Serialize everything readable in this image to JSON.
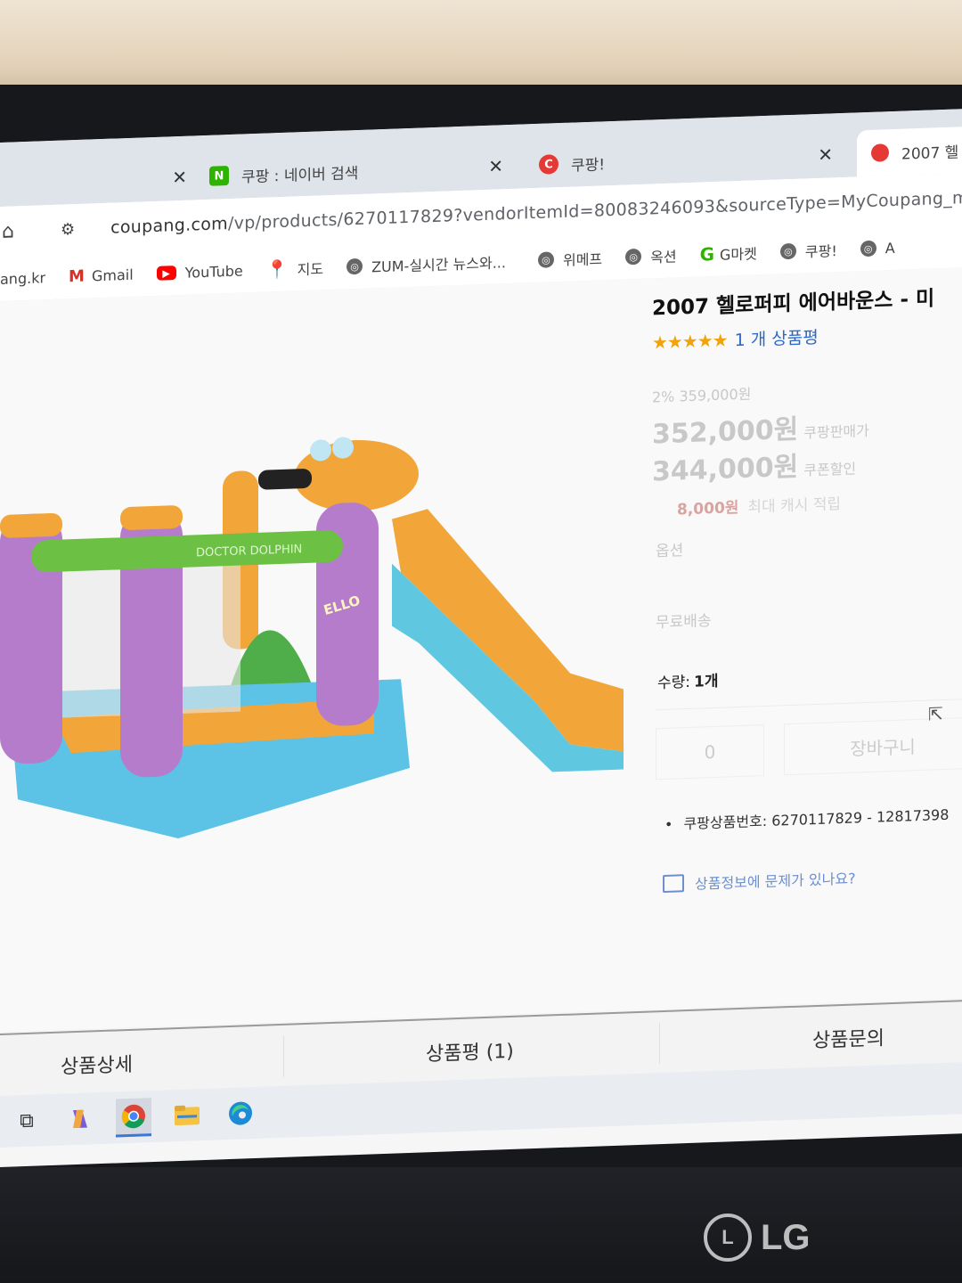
{
  "tabs": [
    {
      "label": "",
      "favicon": "blank"
    },
    {
      "label": "쿠팡 : 네이버 검색",
      "favicon": "naver-icon",
      "favicon_text": "N"
    },
    {
      "label": "쿠팡!",
      "favicon": "coupang-icon",
      "favicon_text": "C"
    },
    {
      "label": "2007 헬",
      "favicon": "coupang-icon"
    }
  ],
  "address": {
    "domain": "coupang.com",
    "path": "/vp/products/6270117829?vendorItemId=80083246093&sourceType=MyCoupang_my_"
  },
  "bookmarks": [
    {
      "label": "ang.kr",
      "icon": "none"
    },
    {
      "label": "Gmail",
      "icon": "gmail-icon"
    },
    {
      "label": "YouTube",
      "icon": "youtube-icon"
    },
    {
      "label": "지도",
      "icon": "maps-icon"
    },
    {
      "label": "ZUM-실시간 뉴스와...",
      "icon": "globe-icon"
    },
    {
      "label": "위메프",
      "icon": "globe-icon"
    },
    {
      "label": "옥션",
      "icon": "globe-icon"
    },
    {
      "label": "G마켓",
      "icon": "gmarket-icon"
    },
    {
      "label": "쿠팡!",
      "icon": "globe-icon"
    },
    {
      "label": "A",
      "icon": "globe-icon"
    }
  ],
  "product": {
    "title": "2007 헬로퍼피 에어바운스 - 미",
    "stars": "★★★★★",
    "review_link": "1 개 상품평",
    "discount_line": "2% 359,000원",
    "price_main": "352,000원",
    "price_main_note": "쿠팡판매가",
    "price_coupon": "344,000원",
    "price_coupon_note": "쿠폰할인",
    "cash": "8,000원",
    "cash_note": "최대 캐시 적립",
    "option_label": "옵션",
    "free_shipping": "무료배송",
    "qty_label": "수량:",
    "qty_value": "1개",
    "qty_input": "0",
    "cart_button": "장바구니",
    "product_number": "쿠팡상품번호: 6270117829 - 12817398",
    "report_link": "상품정보에 문제가 있나요?",
    "image_text": "DOCTOR DOLPHIN",
    "image_text2": "ELLO"
  },
  "page_tabs": [
    "상품상세",
    "상품평 (1)",
    "상품문의"
  ],
  "taskbar": [
    "taskview-icon",
    "copilot-icon",
    "chrome-icon",
    "folder-icon",
    "edge-icon"
  ],
  "brand": "LG"
}
